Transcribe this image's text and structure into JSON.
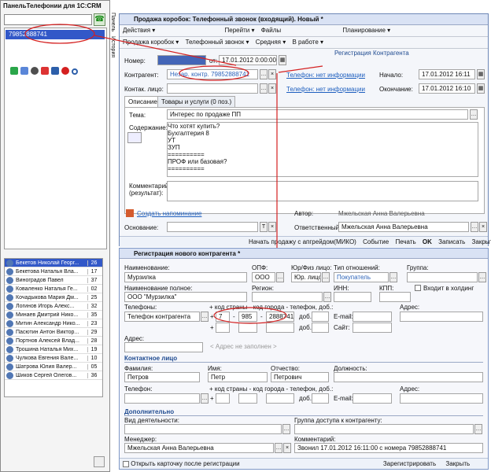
{
  "left_panel": {
    "title": "ПанельТелефонии для 1С:CRM",
    "phone_value": "",
    "call_item": "79852888741",
    "side_tabs": [
      "Панель",
      "История"
    ],
    "contacts": [
      {
        "name": "Бекетов Николай Георг...",
        "ext": "26"
      },
      {
        "name": "Бекетова Наталья Вла...",
        "ext": "17"
      },
      {
        "name": "Виноградов Павел",
        "ext": "37"
      },
      {
        "name": "Коваленко Наталья Ге...",
        "ext": "02"
      },
      {
        "name": "Кочадыкова Мария Дм...",
        "ext": "25"
      },
      {
        "name": "Логинов Игорь Алекс...",
        "ext": "32"
      },
      {
        "name": "Минаев Дмитрий Нико...",
        "ext": "35"
      },
      {
        "name": "Митин Александр Нико...",
        "ext": "23"
      },
      {
        "name": "Пасютин Антон Виктор...",
        "ext": "29"
      },
      {
        "name": "Портнов Алексей Влад...",
        "ext": "28"
      },
      {
        "name": "Трошина Наталья Мих...",
        "ext": "19"
      },
      {
        "name": "Чулкова Евгения Вале...",
        "ext": "10"
      },
      {
        "name": "Шатрова Юлия Валер...",
        "ext": "05"
      },
      {
        "name": "Шиков Сергей Олегов...",
        "ext": "36"
      }
    ]
  },
  "window1": {
    "title": "Продажа коробок: Телефонный звонок (входящий). Новый *",
    "toolbar1": [
      "Действия ▾",
      "Перейти ▾",
      "Файлы",
      "Планирование ▾"
    ],
    "toolbar2": [
      "Продажа коробок ▾",
      "Телефонный звонок ▾",
      "Средняя ▾",
      "В работе ▾"
    ],
    "number_label": "Номер:",
    "from_label": "от:",
    "date_value": "17.01.2012 0:00:00",
    "reg_label": "Регистрация Контрагента",
    "counterparty_label": "Контрагент:",
    "counterparty_value": "Незар. контр. 79852888741",
    "phone_link": "Телефон: нет информации",
    "start_label": "Начало:",
    "start_value": "17.01.2012 16:11",
    "contact_label": "Контак. лицо:",
    "phone_link2": "Телефон: нет информации",
    "end_label": "Окончание:",
    "end_value": "17.01.2012 16:10",
    "tab_desc": "Описание",
    "tab_goods": "Товары и услуги (0 поз.)",
    "topic_label": "Тема:",
    "topic_value": "Интерес по продаже ПП",
    "content_label": "Содержание:",
    "content_lines": [
      "Что хотят купить?",
      "Бухгалтерия 8",
      "УТ",
      "ЗУП",
      "",
      "==========",
      "ПРОФ или базовая?",
      "=========="
    ],
    "comment_label": "Комментарий (результат):",
    "create_reminder": "Создать напоминание",
    "author_label": "Автор:",
    "author_value": "Мжельская Анна Валерьевна",
    "basis_label": "Основание:",
    "responsible_label": "Ответственный:",
    "responsible_value": "Мжельская Анна Валерьевна",
    "bottom_actions": [
      "Начать продажу с апгрейдом(МИКО)",
      "Событие",
      "Печать",
      "OK",
      "Записать",
      "Закрыть"
    ]
  },
  "window2": {
    "title": "Регистрация нового контрагента *",
    "name_label": "Наименование:",
    "name_value": "Мурзилка",
    "opf_label": "ОПФ:",
    "opf_value": "ООО",
    "yur_label": "Юр/Физ лицо:",
    "yur_value": "Юр. лицо",
    "rel_label": "Тип отношений:",
    "rel_value": "Покупатель",
    "group_label": "Группа:",
    "full_name_label": "Наименование полное:",
    "full_name_value": "ООО \"Мурзилка\"",
    "region_label": "Регион:",
    "inn_label": "ИНН:",
    "kpp_label": "КПП:",
    "holding_label": "Входит в холдинг",
    "phones_label": "Телефоны:",
    "phone_hint": "+ код страны - код города - телефон, доб.:",
    "phone_type": "Телефон контрагента",
    "phone_country": "7",
    "phone_city": "985",
    "phone_number": "2888741",
    "dob_label": "доб.:",
    "email_label": "E-mail:",
    "site_label": "Сайт:",
    "address_label": "Адрес:",
    "address_hint": "< Адрес не заполнен >",
    "contact_section": "Контактное лицо",
    "last_name_label": "Фамилия:",
    "last_name_value": "Петров",
    "first_name_label": "Имя:",
    "first_name_value": "Петр",
    "middle_name_label": "Отчество:",
    "middle_name_value": "Петрович",
    "position_label": "Должность:",
    "phone_label": "Телефон:",
    "additional_section": "Дополнительно",
    "activity_label": "Вид деятельности:",
    "access_label": "Группа доступа к контрагенту:",
    "manager_label": "Менеджер:",
    "manager_value": "Мжельская Анна Валерьевна",
    "comment_label": "Комментарий:",
    "comment_value": "Звонил 17.01.2012 16:11:00 с номера 79852888741",
    "open_card_label": "Открыть карточку после регистрации",
    "register_btn": "Зарегистрировать",
    "close_btn": "Закрыть"
  }
}
